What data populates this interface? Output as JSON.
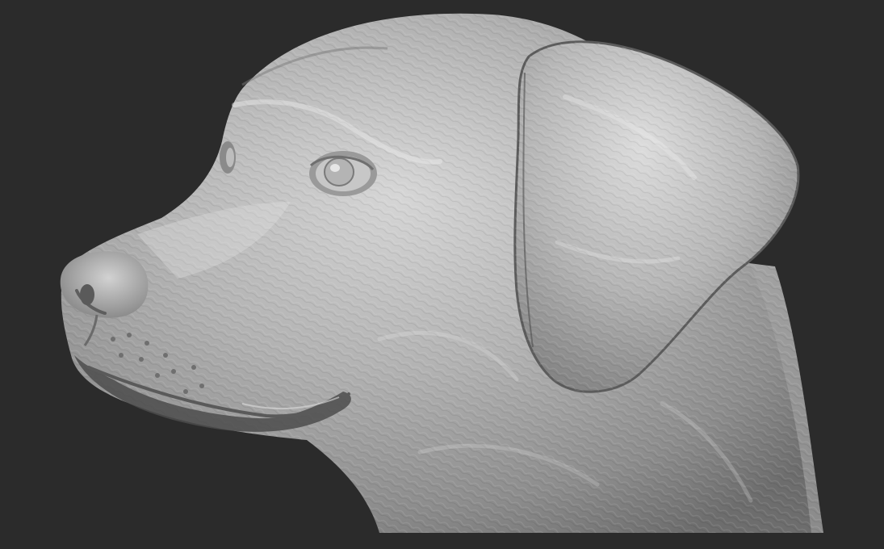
{
  "scene": {
    "subject": "sculpted-dog-head-bust",
    "background_color": "#2b2b2b",
    "material_color": "#a9a9a9",
    "highlight_color": "#d8d8d8",
    "shadow_color": "#4a4a4a"
  }
}
